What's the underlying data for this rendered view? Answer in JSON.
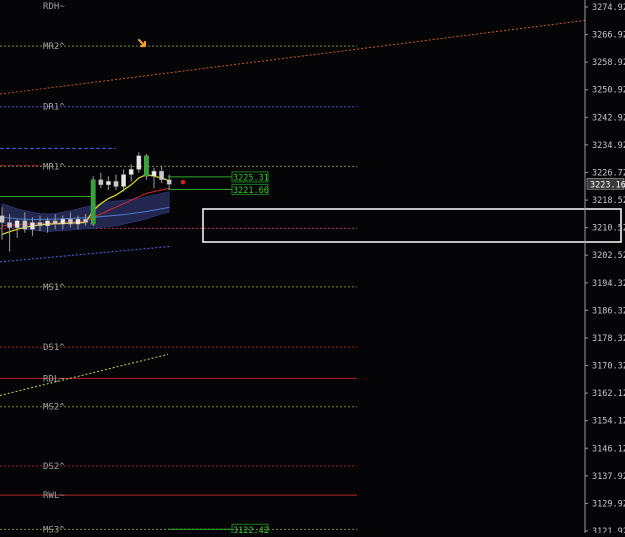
{
  "colors": {
    "background": "#050507",
    "axis_text": "#c8c8c8",
    "level_label": "#a0a0a0",
    "resistance_dotted": "#7a8a2a",
    "pivot_blue": "#3a55d8",
    "support_red": "#a02020",
    "orange_trend": "#d05a20",
    "yellow_trend": "#cfcf60",
    "band_fill": "#23274f",
    "candle_bull": "#2ea82e",
    "candle_body": "#c8c8c8",
    "price_box": "#1d7a1d",
    "highlight_box": "#ffffff"
  },
  "chart_data": {
    "type": "candlestick",
    "y_axis": {
      "min": 3121.92,
      "max": 3274.92,
      "ticks": [
        "3274.92",
        "3266.92",
        "3258.92",
        "3250.92",
        "3242.92",
        "3234.92",
        "3226.72",
        "3218.52",
        "3210.52",
        "3202.52",
        "3194.32",
        "3186.32",
        "3178.32",
        "3170.32",
        "3162.12",
        "3154.12",
        "3146.12",
        "3137.92",
        "3129.92",
        "3121.92"
      ],
      "current_price_label": "3223.16",
      "current_price_value": 3223.16
    },
    "levels": [
      {
        "label": "RDH~",
        "value": 3275.2,
        "style": "none"
      },
      {
        "label": "MR2^",
        "value": 3263.5,
        "style": "dotted-olive"
      },
      {
        "label": "DR1^",
        "value": 3245.8,
        "style": "dotted-blue"
      },
      {
        "label": "MR1^",
        "value": 3228.4,
        "style": "dotted-olive"
      },
      {
        "label": "",
        "value": 3210.3,
        "style": "dotted-magenta"
      },
      {
        "label": "MS1^",
        "value": 3193.2,
        "style": "dotted-olive"
      },
      {
        "label": "DS1^",
        "value": 3175.6,
        "style": "dotted-red"
      },
      {
        "label": "RDL~",
        "value": 3166.5,
        "style": "solid-red"
      },
      {
        "label": "MS2^",
        "value": 3158.2,
        "style": "dotted-olive"
      },
      {
        "label": "DS2^",
        "value": 3140.9,
        "style": "dotted-red"
      },
      {
        "label": "RWL~",
        "value": 3132.4,
        "style": "solid-red"
      },
      {
        "label": "MS3^",
        "value": 3122.4,
        "style": "dotted-olive"
      }
    ],
    "price_boxes": [
      {
        "text": "3225.31",
        "value": 3225.31
      },
      {
        "text": "3221.66",
        "value": 3221.66
      },
      {
        "text": "3122.42",
        "value": 3122.42
      }
    ],
    "candles": [
      {
        "o": 3214.0,
        "h": 3216.5,
        "l": 3207.0,
        "c": 3212.0
      },
      {
        "o": 3212.0,
        "h": 3214.5,
        "l": 3203.5,
        "c": 3210.5
      },
      {
        "o": 3210.5,
        "h": 3213.0,
        "l": 3207.5,
        "c": 3212.5
      },
      {
        "o": 3212.5,
        "h": 3215.0,
        "l": 3209.0,
        "c": 3210.0
      },
      {
        "o": 3210.0,
        "h": 3213.5,
        "l": 3208.0,
        "c": 3212.0
      },
      {
        "o": 3212.0,
        "h": 3214.0,
        "l": 3209.5,
        "c": 3211.0
      },
      {
        "o": 3211.0,
        "h": 3213.5,
        "l": 3209.0,
        "c": 3212.5
      },
      {
        "o": 3212.5,
        "h": 3214.5,
        "l": 3210.0,
        "c": 3211.5
      },
      {
        "o": 3211.5,
        "h": 3214.0,
        "l": 3210.0,
        "c": 3213.0
      },
      {
        "o": 3213.0,
        "h": 3215.0,
        "l": 3210.5,
        "c": 3211.5
      },
      {
        "o": 3211.5,
        "h": 3214.0,
        "l": 3210.0,
        "c": 3213.0
      },
      {
        "o": 3213.0,
        "h": 3214.5,
        "l": 3211.0,
        "c": 3212.0
      },
      {
        "o": 3211.5,
        "h": 3225.5,
        "l": 3211.0,
        "c": 3224.5
      },
      {
        "o": 3224.5,
        "h": 3226.5,
        "l": 3222.0,
        "c": 3223.0
      },
      {
        "o": 3223.0,
        "h": 3225.5,
        "l": 3221.5,
        "c": 3224.0
      },
      {
        "o": 3224.0,
        "h": 3226.0,
        "l": 3221.5,
        "c": 3222.5
      },
      {
        "o": 3222.5,
        "h": 3227.5,
        "l": 3221.0,
        "c": 3226.0
      },
      {
        "o": 3226.0,
        "h": 3229.0,
        "l": 3224.0,
        "c": 3227.5
      },
      {
        "o": 3227.5,
        "h": 3232.5,
        "l": 3226.5,
        "c": 3231.5
      },
      {
        "o": 3231.5,
        "h": 3232.0,
        "l": 3224.5,
        "c": 3225.5
      },
      {
        "o": 3225.5,
        "h": 3228.0,
        "l": 3222.0,
        "c": 3227.0
      },
      {
        "o": 3227.0,
        "h": 3228.5,
        "l": 3223.5,
        "c": 3224.5
      },
      {
        "o": 3224.5,
        "h": 3226.0,
        "l": 3221.5,
        "c": 3223.16
      }
    ],
    "band": {
      "upper": [
        3217.5,
        3216.8,
        3216.0,
        3215.5,
        3215.0,
        3214.6,
        3214.5,
        3214.6,
        3215.0,
        3215.5,
        3216.0,
        3216.6,
        3217.0,
        3217.5,
        3218.0,
        3218.3,
        3218.5,
        3218.8,
        3219.0,
        3219.5,
        3220.0,
        3220.5,
        3221.0
      ],
      "lower": [
        3212.0,
        3211.0,
        3210.5,
        3210.0,
        3209.8,
        3209.5,
        3209.4,
        3209.5,
        3209.6,
        3209.8,
        3210.0,
        3210.2,
        3210.3,
        3210.5,
        3210.8,
        3211.0,
        3211.5,
        3212.0,
        3212.5,
        3213.0,
        3213.8,
        3214.5,
        3215.0
      ]
    },
    "ma_fast": [
      3208.5,
      3209.3,
      3210.0,
      3210.6,
      3211.0,
      3211.3,
      3211.5,
      3211.6,
      3211.7,
      3211.8,
      3211.9,
      3212.0,
      3215.5,
      3217.5,
      3219.0,
      3220.0,
      3221.5,
      3223.0,
      3225.0,
      3226.0,
      3225.5,
      3225.0,
      3224.2
    ],
    "ma_red": [
      3211.0,
      3211.2,
      3211.4,
      3211.5,
      3211.6,
      3211.7,
      3211.8,
      3211.9,
      3212.0,
      3212.1,
      3212.2,
      3212.4,
      3213.5,
      3214.5,
      3215.5,
      3216.5,
      3217.5,
      3218.5,
      3219.5,
      3220.5,
      3221.0,
      3221.5,
      3222.0
    ],
    "ma_teal": [
      3213.5,
      3213.3,
      3213.1,
      3213.0,
      3212.9,
      3212.9,
      3212.9,
      3213.0,
      3213.1,
      3213.2,
      3213.3,
      3213.4,
      3213.5,
      3213.7,
      3213.9,
      3214.1,
      3214.3,
      3214.6,
      3214.9,
      3215.2,
      3215.6,
      3216.0,
      3216.4
    ],
    "blue_trend_dotted": [
      [
        3204.5,
        0
      ],
      [
        3216.0,
        1
      ]
    ],
    "orange_trend": [
      3249.5,
      3271.0
    ],
    "yellow_trend": [
      3161.5,
      3173.5
    ]
  }
}
